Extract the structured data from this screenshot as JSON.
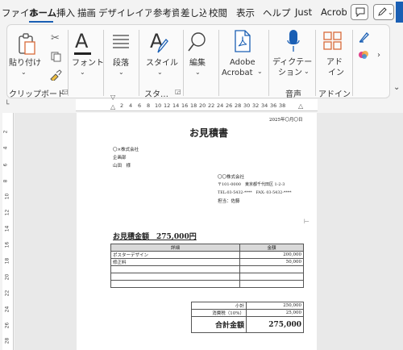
{
  "tabs": {
    "items": [
      "ファイル",
      "ホーム",
      "挿入",
      "描画",
      "デザイン",
      "レイアウト",
      "参考資料",
      "差し込み",
      "校閲",
      "表示",
      "ヘルプ",
      "Just",
      "Acrobat"
    ],
    "active": "ホーム"
  },
  "ribbon": {
    "paste": {
      "label": "貼り付け",
      "group": "クリップボード"
    },
    "font": {
      "label": "フォント"
    },
    "paragraph": {
      "label": "段落"
    },
    "styles": {
      "label": "スタイル",
      "group": "スタ…"
    },
    "edit": {
      "label": "編集"
    },
    "adobe": {
      "label_line1": "Adobe",
      "label_line2": "Acrobat"
    },
    "dictation": {
      "label_line1": "ディクテー",
      "label_line2": "ション",
      "group": "音声"
    },
    "addin": {
      "label_line1": "アド",
      "label_line2": "イン",
      "group": "アドイン"
    }
  },
  "ruler": {
    "h_ticks": [
      "2",
      "4",
      "6",
      "8",
      "10",
      "12",
      "14",
      "16",
      "18",
      "20",
      "22",
      "24",
      "26",
      "28",
      "30",
      "32",
      "34",
      "36",
      "38"
    ],
    "v_ticks": [
      "2",
      "4",
      "6",
      "8",
      "10",
      "12",
      "14",
      "16",
      "18",
      "20",
      "22",
      "24",
      "26",
      "28"
    ]
  },
  "document": {
    "date": "2025年〇月〇日",
    "title": "お見積書",
    "recipient_company": "〇×株式会社",
    "recipient_dept": "企画部",
    "recipient_name": "山田　様",
    "sender_company": "〇〇株式会社",
    "sender_address": "〒101-0000　東京都千代田区 1-2-3",
    "sender_phone": "TEL:03-5432-****　FAX: 03-5432-****",
    "sender_person": "担当：佐藤",
    "total_label": "お見積金額　275,000円",
    "table": {
      "headers": [
        "詳細",
        "金額"
      ],
      "rows": [
        {
          "detail": "ポスターデザイン",
          "amount": "200,000"
        },
        {
          "detail": "修正料",
          "amount": "50,000"
        },
        {
          "detail": "",
          "amount": ""
        },
        {
          "detail": "",
          "amount": ""
        },
        {
          "detail": "",
          "amount": ""
        }
      ]
    },
    "summary": {
      "subtotal_label": "小計",
      "subtotal_value": "250,000",
      "tax_label": "消費税（10%）",
      "tax_value": "25,000",
      "grand_label": "合計金額",
      "grand_value": "275,000"
    }
  },
  "colors": {
    "accent": "#1a5fb4",
    "addin": "#d86b3a",
    "dictation": "#1a5fb4"
  }
}
